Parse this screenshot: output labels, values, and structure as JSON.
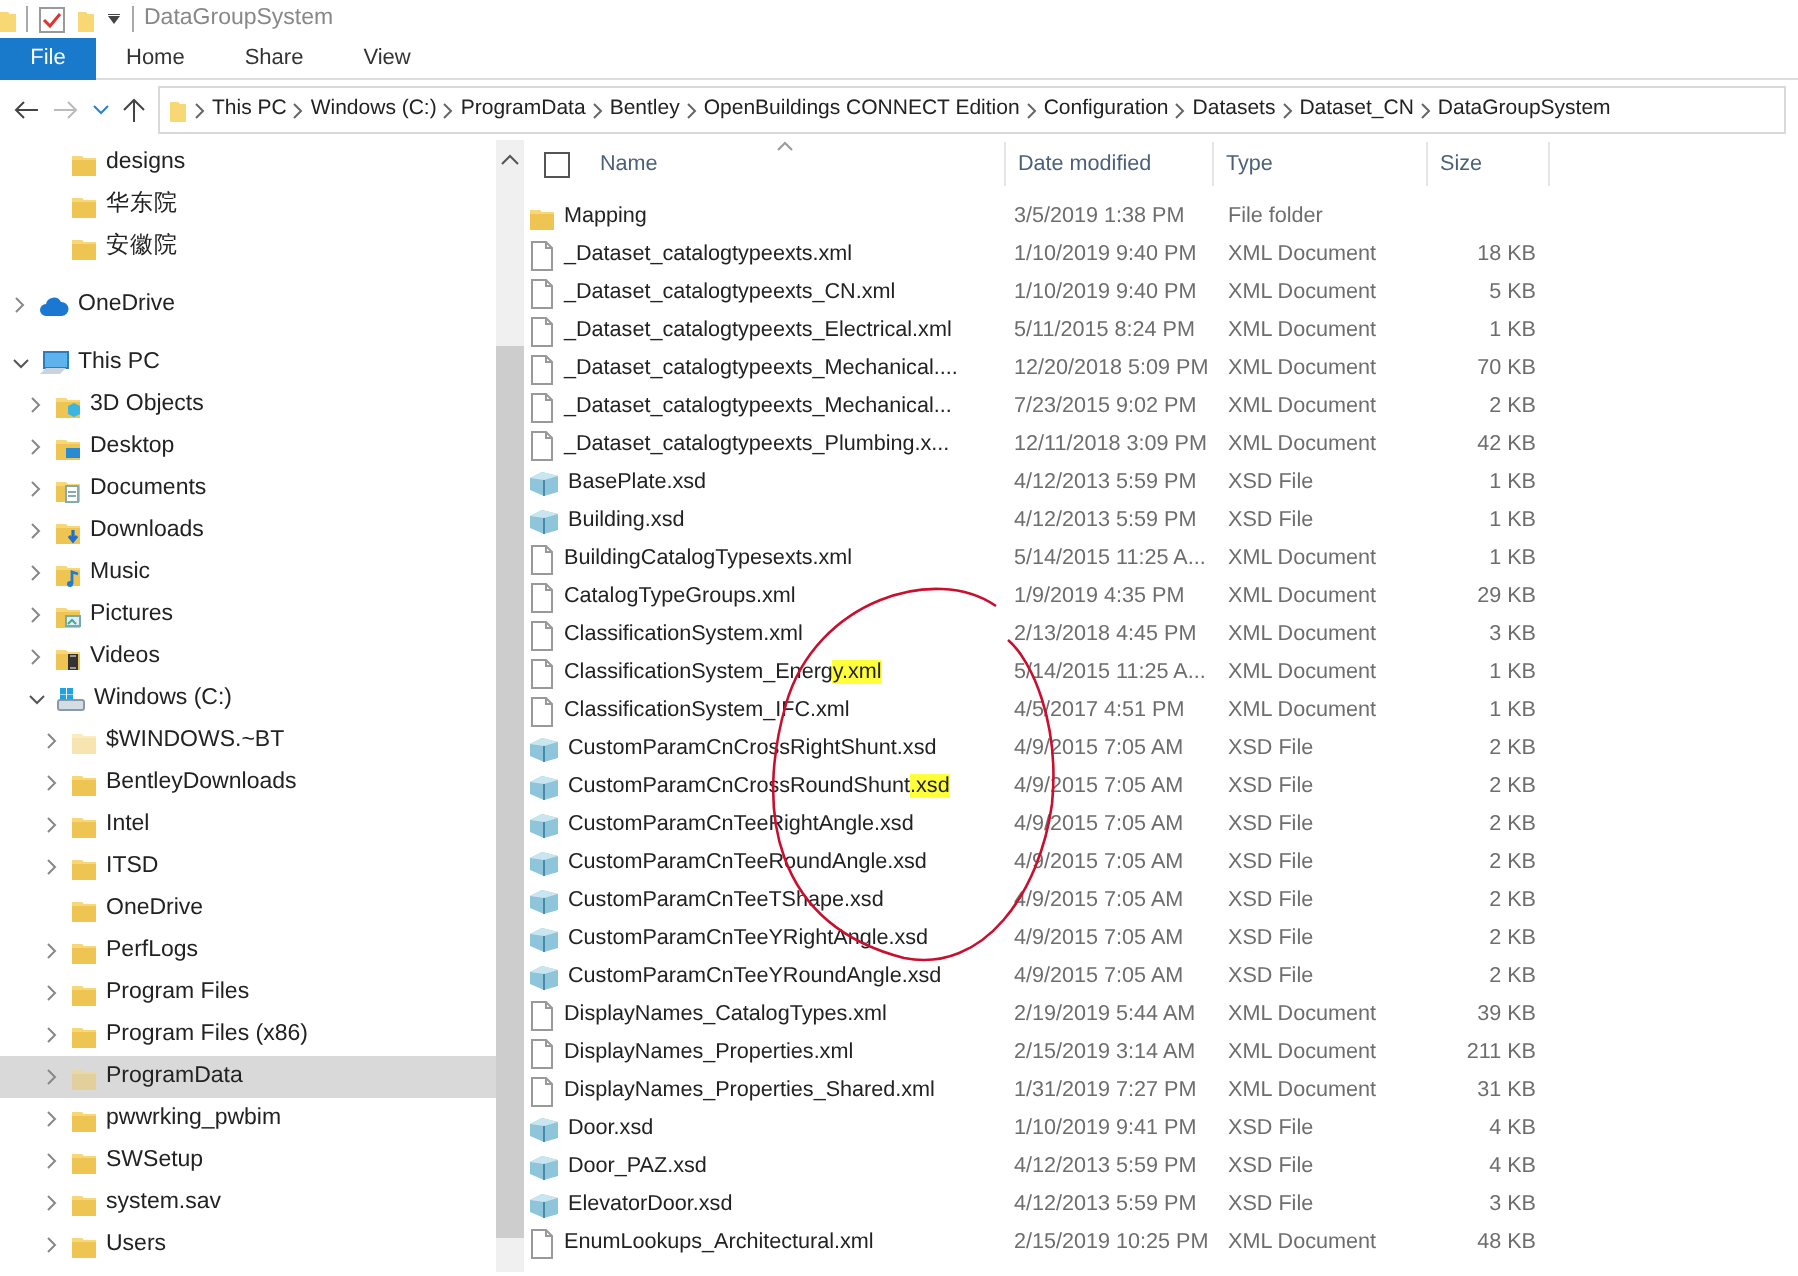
{
  "titlebar": {
    "title": "DataGroupSystem"
  },
  "ribbon_tabs": [
    {
      "label": "File",
      "kind": "file"
    },
    {
      "label": "Home",
      "kind": "tab"
    },
    {
      "label": "Share",
      "kind": "tab"
    },
    {
      "label": "View",
      "kind": "tab"
    }
  ],
  "address_bar": {
    "back_enabled": true,
    "forward_enabled": false,
    "breadcrumb": [
      "This PC",
      "Windows (C:)",
      "ProgramData",
      "Bentley",
      "OpenBuildings CONNECT Edition",
      "Configuration",
      "Datasets",
      "Dataset_CN",
      "DataGroupSystem"
    ]
  },
  "sidebar": {
    "quick_access_items": [
      {
        "label": "designs",
        "kind": "folder",
        "expandable": false,
        "selected": false
      },
      {
        "label": "华东院",
        "kind": "folder",
        "expandable": false,
        "selected": false
      },
      {
        "label": "安徽院",
        "kind": "folder",
        "expandable": false,
        "selected": false
      }
    ],
    "groups": [
      {
        "label": "OneDrive",
        "kind": "cloud",
        "expandable": true,
        "expanded": false,
        "selected": false
      },
      {
        "label": "This PC",
        "kind": "computer",
        "expandable": true,
        "expanded": true,
        "selected": false,
        "children": [
          {
            "label": "3D Objects",
            "kind": "objects",
            "expandable": true,
            "expanded": false,
            "selected": false
          },
          {
            "label": "Desktop",
            "kind": "desktop",
            "expandable": true,
            "expanded": false,
            "selected": false
          },
          {
            "label": "Documents",
            "kind": "documents",
            "expandable": true,
            "expanded": false,
            "selected": false
          },
          {
            "label": "Downloads",
            "kind": "downloads",
            "expandable": true,
            "expanded": false,
            "selected": false
          },
          {
            "label": "Music",
            "kind": "music",
            "expandable": true,
            "expanded": false,
            "selected": false
          },
          {
            "label": "Pictures",
            "kind": "pictures",
            "expandable": true,
            "expanded": false,
            "selected": false
          },
          {
            "label": "Videos",
            "kind": "videos",
            "expandable": true,
            "expanded": false,
            "selected": false
          },
          {
            "label": "Windows (C:)",
            "kind": "drive",
            "expandable": true,
            "expanded": true,
            "selected": false,
            "children": [
              {
                "label": "$WINDOWS.~BT",
                "kind": "hidden-folder",
                "expandable": true,
                "expanded": false,
                "selected": false
              },
              {
                "label": "BentleyDownloads",
                "kind": "folder",
                "expandable": true,
                "expanded": false,
                "selected": false
              },
              {
                "label": "Intel",
                "kind": "folder",
                "expandable": true,
                "expanded": false,
                "selected": false
              },
              {
                "label": "ITSD",
                "kind": "folder",
                "expandable": true,
                "expanded": false,
                "selected": false
              },
              {
                "label": "OneDrive",
                "kind": "folder",
                "expandable": false,
                "selected": false
              },
              {
                "label": "PerfLogs",
                "kind": "folder",
                "expandable": true,
                "expanded": false,
                "selected": false
              },
              {
                "label": "Program Files",
                "kind": "folder",
                "expandable": true,
                "expanded": false,
                "selected": false
              },
              {
                "label": "Program Files (x86)",
                "kind": "folder",
                "expandable": true,
                "expanded": false,
                "selected": false
              },
              {
                "label": "ProgramData",
                "kind": "hidden-folder",
                "expandable": true,
                "expanded": false,
                "selected": true
              },
              {
                "label": "pwwrking_pwbim",
                "kind": "folder",
                "expandable": true,
                "expanded": false,
                "selected": false
              },
              {
                "label": "SWSetup",
                "kind": "folder",
                "expandable": true,
                "expanded": false,
                "selected": false
              },
              {
                "label": "system.sav",
                "kind": "folder",
                "expandable": true,
                "expanded": false,
                "selected": false
              },
              {
                "label": "Users",
                "kind": "folder",
                "expandable": true,
                "expanded": false,
                "selected": false
              }
            ]
          }
        ]
      }
    ]
  },
  "select_all": {
    "checked": false
  },
  "columns": [
    {
      "label": "Name",
      "sorted": true
    },
    {
      "label": "Date modified",
      "sorted": false
    },
    {
      "label": "Type",
      "sorted": false
    },
    {
      "label": "Size",
      "sorted": false
    }
  ],
  "files": [
    {
      "name": "Mapping",
      "date": "3/5/2019 1:38 PM",
      "type": "File folder",
      "kind": "folder"
    },
    {
      "name": "_Dataset_catalogtypeexts.xml",
      "date": "1/10/2019 9:40 PM",
      "type": "XML Document",
      "size": "18 KB",
      "kind": "xml"
    },
    {
      "name": "_Dataset_catalogtypeexts_CN.xml",
      "date": "1/10/2019 9:40 PM",
      "type": "XML Document",
      "size": "5 KB",
      "kind": "xml"
    },
    {
      "name": "_Dataset_catalogtypeexts_Electrical.xml",
      "date": "5/11/2015 8:24 PM",
      "type": "XML Document",
      "size": "1 KB",
      "kind": "xml"
    },
    {
      "name": "_Dataset_catalogtypeexts_Mechanical....",
      "date": "12/20/2018 5:09 PM",
      "type": "XML Document",
      "size": "70 KB",
      "kind": "xml"
    },
    {
      "name": "_Dataset_catalogtypeexts_Mechanical...",
      "date": "7/23/2015 9:02 PM",
      "type": "XML Document",
      "size": "2 KB",
      "kind": "xml"
    },
    {
      "name": "_Dataset_catalogtypeexts_Plumbing.x...",
      "date": "12/11/2018 3:09 PM",
      "type": "XML Document",
      "size": "42 KB",
      "kind": "xml"
    },
    {
      "name": "BasePlate.xsd",
      "date": "4/12/2013 5:59 PM",
      "type": "XSD File",
      "size": "1 KB",
      "kind": "xsd"
    },
    {
      "name": "Building.xsd",
      "date": "4/12/2013 5:59 PM",
      "type": "XSD File",
      "size": "1 KB",
      "kind": "xsd"
    },
    {
      "name": "BuildingCatalogTypesexts.xml",
      "date": "5/14/2015 11:25 A...",
      "type": "XML Document",
      "size": "1 KB",
      "kind": "xml"
    },
    {
      "name": "CatalogTypeGroups.xml",
      "date": "1/9/2019 4:35 PM",
      "type": "XML Document",
      "size": "29 KB",
      "kind": "xml"
    },
    {
      "name": "ClassificationSystem.xml",
      "date": "2/13/2018 4:45 PM",
      "type": "XML Document",
      "size": "3 KB",
      "kind": "xml"
    },
    {
      "name": "ClassificationSystem_Energ",
      "highlight": "y.xml",
      "date": "5/14/2015 11:25 A...",
      "type": "XML Document",
      "size": "1 KB",
      "kind": "xml"
    },
    {
      "name": "ClassificationSystem_IFC.xml",
      "date": "4/5/2017 4:51 PM",
      "type": "XML Document",
      "size": "1 KB",
      "kind": "xml"
    },
    {
      "name": "CustomParamCnCrossRightShunt.xsd",
      "date": "4/9/2015 7:05 AM",
      "type": "XSD File",
      "size": "2 KB",
      "kind": "xsd"
    },
    {
      "name": "CustomParamCnCrossRoundShunt",
      "highlight": ".xsd",
      "date": "4/9/2015 7:05 AM",
      "type": "XSD File",
      "size": "2 KB",
      "kind": "xsd"
    },
    {
      "name": "CustomParamCnTeeRightAngle.xsd",
      "date": "4/9/2015 7:05 AM",
      "type": "XSD File",
      "size": "2 KB",
      "kind": "xsd"
    },
    {
      "name": "CustomParamCnTeeRoundAngle.xsd",
      "date": "4/9/2015 7:05 AM",
      "type": "XSD File",
      "size": "2 KB",
      "kind": "xsd"
    },
    {
      "name": "CustomParamCnTeeTShape.xsd",
      "date": "4/9/2015 7:05 AM",
      "type": "XSD File",
      "size": "2 KB",
      "kind": "xsd"
    },
    {
      "name": "CustomParamCnTeeYRightAngle.xsd",
      "date": "4/9/2015 7:05 AM",
      "type": "XSD File",
      "size": "2 KB",
      "kind": "xsd"
    },
    {
      "name": "CustomParamCnTeeYRoundAngle.xsd",
      "date": "4/9/2015 7:05 AM",
      "type": "XSD File",
      "size": "2 KB",
      "kind": "xsd"
    },
    {
      "name": "DisplayNames_CatalogTypes.xml",
      "date": "2/19/2019 5:44 AM",
      "type": "XML Document",
      "size": "39 KB",
      "kind": "xml"
    },
    {
      "name": "DisplayNames_Properties.xml",
      "date": "2/15/2019 3:14 AM",
      "type": "XML Document",
      "size": "211 KB",
      "kind": "xml"
    },
    {
      "name": "DisplayNames_Properties_Shared.xml",
      "date": "1/31/2019 7:27 PM",
      "type": "XML Document",
      "size": "31 KB",
      "kind": "xml"
    },
    {
      "name": "Door.xsd",
      "date": "1/10/2019 9:41 PM",
      "type": "XSD File",
      "size": "4 KB",
      "kind": "xsd"
    },
    {
      "name": "Door_PAZ.xsd",
      "date": "4/12/2013 5:59 PM",
      "type": "XSD File",
      "size": "4 KB",
      "kind": "xsd"
    },
    {
      "name": "ElevatorDoor.xsd",
      "date": "4/12/2013 5:59 PM",
      "type": "XSD File",
      "size": "3 KB",
      "kind": "xsd"
    },
    {
      "name": "EnumLookups_Architectural.xml",
      "date": "2/15/2019 10:25 PM",
      "type": "XML Document",
      "size": "48 KB",
      "kind": "xml"
    }
  ],
  "annotation": {
    "kind": "freehand-circle"
  }
}
